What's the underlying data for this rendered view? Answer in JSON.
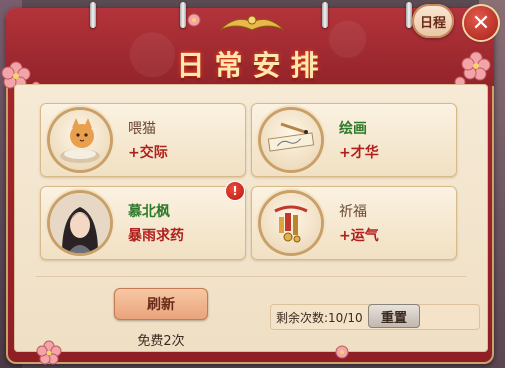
{
  "header": {
    "title": "日常安排",
    "schedule_label": "日程",
    "close_label": "✕"
  },
  "activities": [
    {
      "name": "喂猫",
      "effect": "+交际",
      "name_color": "#6b4a33",
      "icon": "cat-with-fish-bowl-icon"
    },
    {
      "name": "绘画",
      "effect": "+才华",
      "name_color": "#2e7a2a",
      "icon": "painting-scroll-icon"
    },
    {
      "name": "慕北枫",
      "subtitle": "暴雨求药",
      "name_color": "#2e7a2a",
      "icon": "character-portrait",
      "alert": "!"
    },
    {
      "name": "祈福",
      "effect": "+运气",
      "name_color": "#6b4a33",
      "icon": "prayer-charm-icon"
    }
  ],
  "footer": {
    "refresh_label": "刷新",
    "free_text": "免费2次",
    "remaining_label": "剩余次数:",
    "remaining_value": "10/10",
    "reset_label": "重置"
  },
  "colors": {
    "frame_red": "#a8282e",
    "parchment": "#f6ead6",
    "effect_red": "#b01f1a",
    "name_green": "#2e7a2a"
  }
}
